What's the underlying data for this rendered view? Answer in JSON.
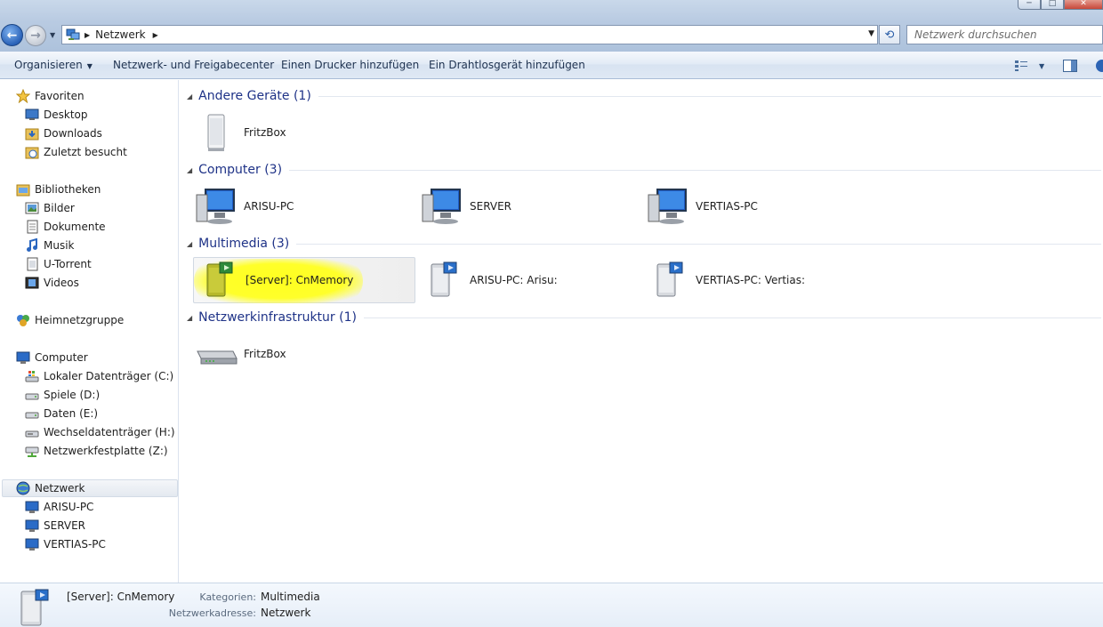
{
  "window": {
    "minimize": "─",
    "maximize": "□",
    "close": "✕"
  },
  "address": {
    "segment": "Netzwerk",
    "icon": "network-icon"
  },
  "search": {
    "placeholder": "Netzwerk durchsuchen"
  },
  "toolbar": {
    "organize": "Organisieren",
    "network_center": "Netzwerk- und Freigabecenter",
    "add_printer": "Einen Drucker hinzufügen",
    "add_wireless": "Ein Drahtlosgerät hinzufügen"
  },
  "sidebar": {
    "favorites": {
      "label": "Favoriten",
      "items": [
        "Desktop",
        "Downloads",
        "Zuletzt besucht"
      ]
    },
    "libraries": {
      "label": "Bibliotheken",
      "items": [
        "Bilder",
        "Dokumente",
        "Musik",
        "U-Torrent",
        "Videos"
      ]
    },
    "homegroup": "Heimnetzgruppe",
    "computer": {
      "label": "Computer",
      "items": [
        "Lokaler Datenträger (C:)",
        "Spiele (D:)",
        "Daten (E:)",
        "Wechseldatenträger (H:)",
        "Netzwerkfestplatte (Z:)"
      ]
    },
    "network": {
      "label": "Netzwerk",
      "items": [
        "ARISU-PC",
        "SERVER",
        "VERTIAS-PC"
      ]
    }
  },
  "groups": [
    {
      "title": "Andere Geräte (1)",
      "items": [
        "FritzBox"
      ]
    },
    {
      "title": "Computer (3)",
      "items": [
        "ARISU-PC",
        "SERVER",
        "VERTIAS-PC"
      ]
    },
    {
      "title": "Multimedia (3)",
      "items": [
        "[Server]: CnMemory",
        "ARISU-PC: Arisu:",
        "VERTIAS-PC: Vertias:"
      ]
    },
    {
      "title": "Netzwerkinfrastruktur (1)",
      "items": [
        "FritzBox"
      ]
    }
  ],
  "details": {
    "name": "[Server]: CnMemory",
    "category_label": "Kategorien:",
    "category_value": "Multimedia",
    "address_label": "Netzwerkadresse:",
    "address_value": "Netzwerk"
  },
  "colors": {
    "highlight": "#ffff20",
    "group_title": "#1e3287"
  }
}
